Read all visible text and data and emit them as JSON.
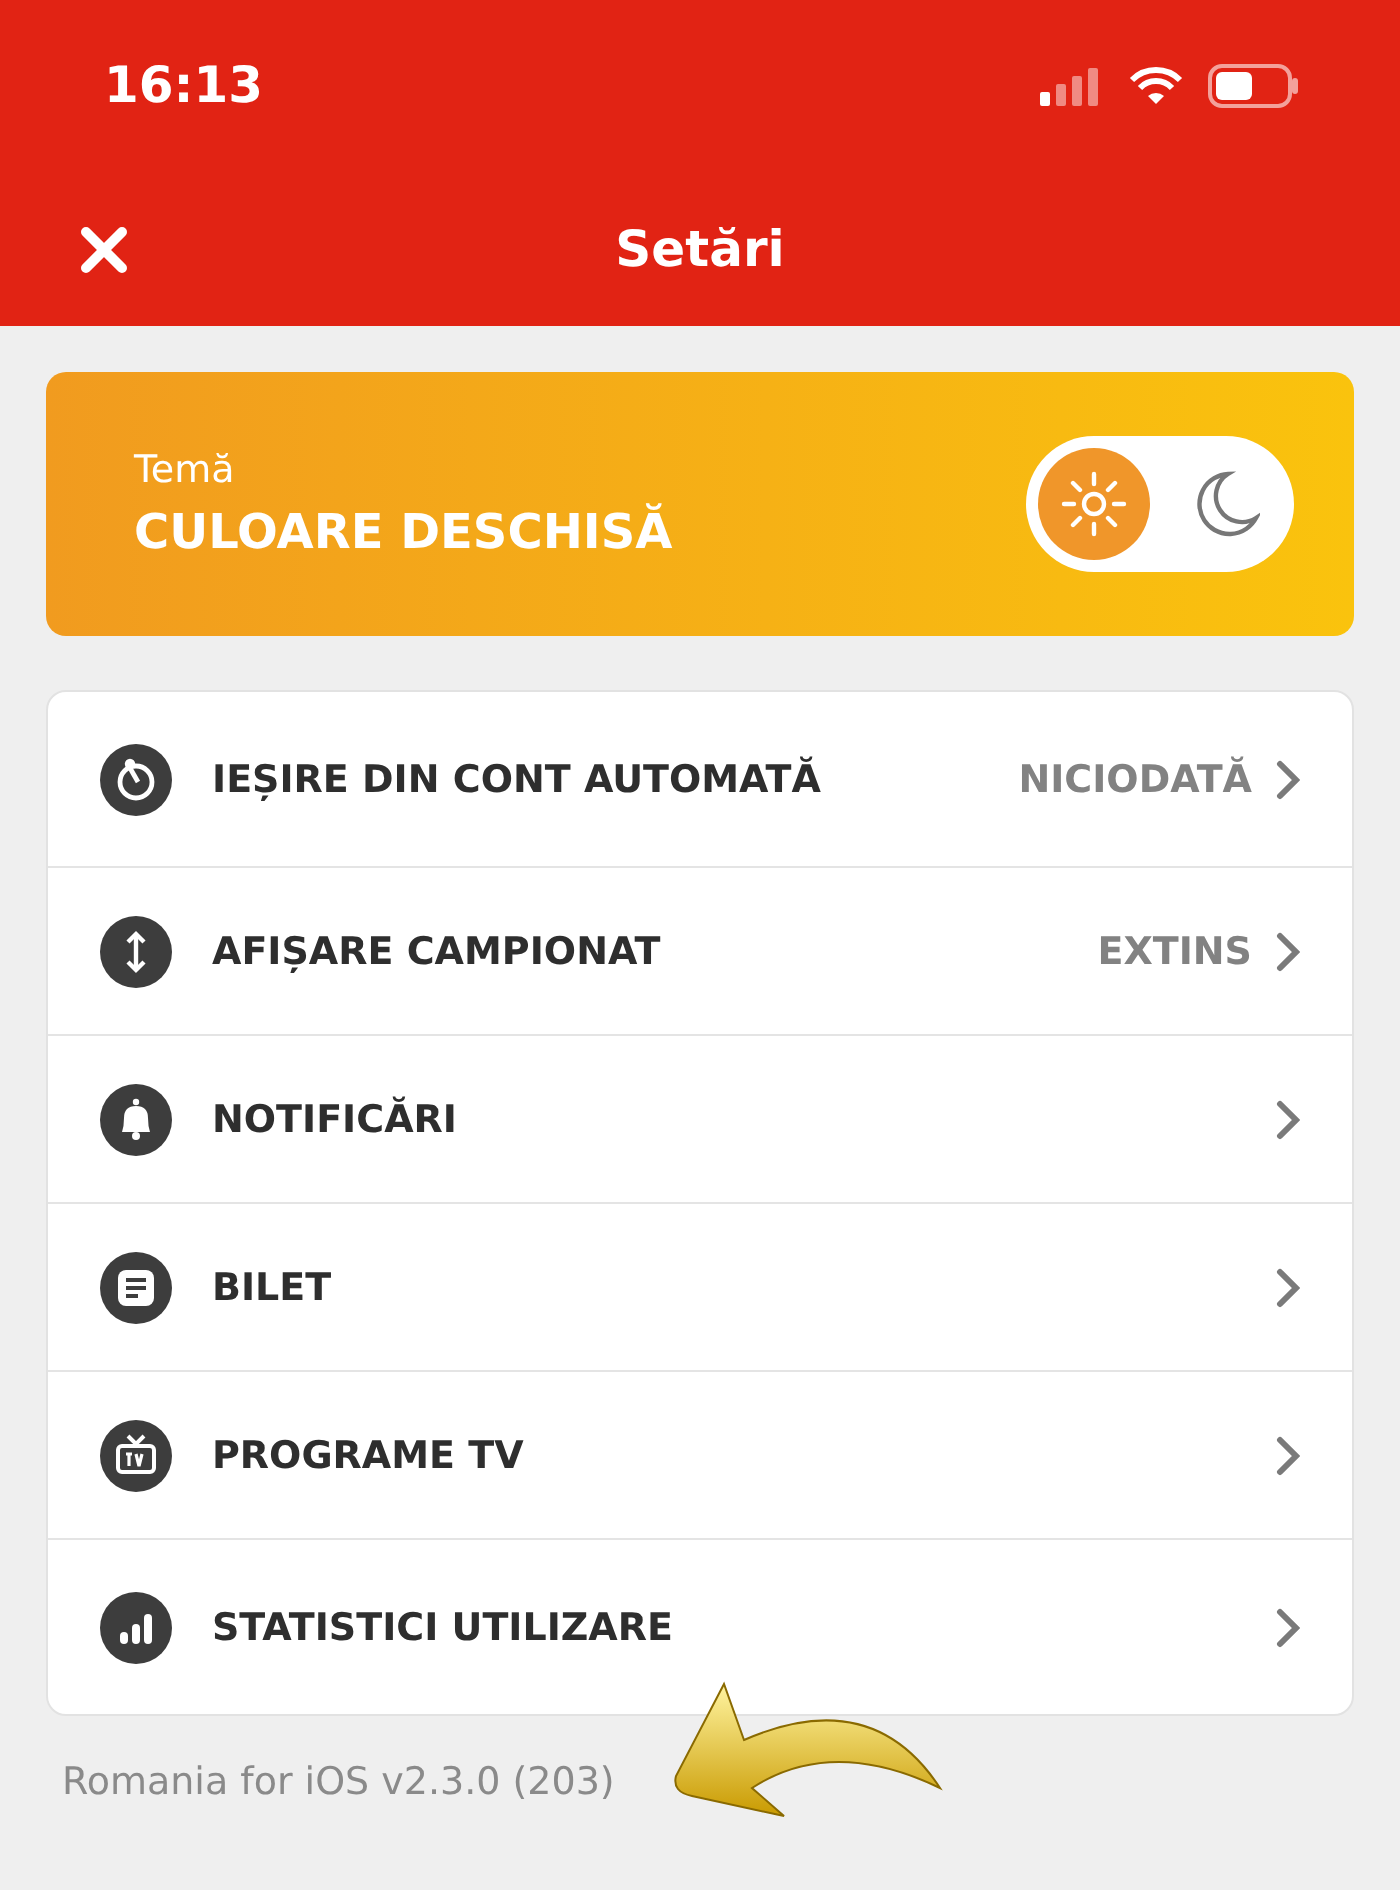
{
  "status_bar": {
    "time": "16:13"
  },
  "header": {
    "title": "Setări"
  },
  "theme": {
    "label": "Temă",
    "value": "CULOARE DESCHISĂ",
    "options": [
      {
        "kind": "sun",
        "selected": true
      },
      {
        "kind": "moon",
        "selected": false
      }
    ]
  },
  "settings": [
    {
      "kind": "timer",
      "label": "IEȘIRE DIN CONT AUTOMATĂ",
      "value": "NICIODATĂ"
    },
    {
      "kind": "arrows",
      "label": "AFIȘARE CAMPIONAT",
      "value": "EXTINS"
    },
    {
      "kind": "bell",
      "label": "NOTIFICĂRI"
    },
    {
      "kind": "ticket",
      "label": "BILET"
    },
    {
      "kind": "tv",
      "label": "PROGRAME TV"
    },
    {
      "kind": "stats",
      "label": "STATISTICI UTILIZARE"
    }
  ],
  "version": "Romania for iOS v2.3.0 (203)"
}
